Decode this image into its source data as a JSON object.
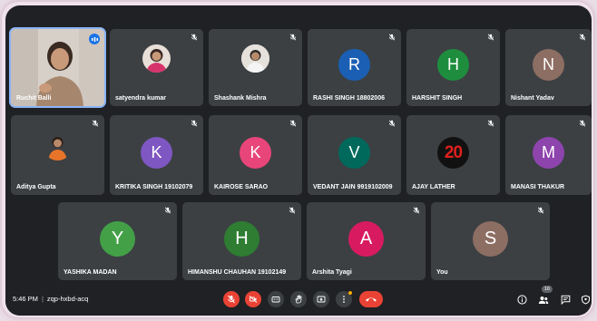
{
  "tiles": [
    {
      "name": "Ruchit Balli",
      "type": "video"
    },
    {
      "name": "satyendra kumar",
      "type": "photo"
    },
    {
      "name": "Shashank Mishra",
      "type": "photo"
    },
    {
      "name": "RASHI SINGH 18802006",
      "initial": "R",
      "color": "#1a5fb4"
    },
    {
      "name": "HARSHIT SINGH",
      "initial": "H",
      "color": "#1e8e3e"
    },
    {
      "name": "Nishant Yadav",
      "initial": "N",
      "color": "#8d6e63"
    },
    {
      "name": "Aditya Gupta",
      "type": "photo"
    },
    {
      "name": "KRITIKA SINGH 19102079",
      "initial": "K",
      "color": "#7e57c2"
    },
    {
      "name": "KAIROSE SARAO",
      "initial": "K",
      "color": "#e8457a"
    },
    {
      "name": "VEDANT JAIN 9919102009",
      "initial": "V",
      "color": "#00695c"
    },
    {
      "name": "AJAY LATHER",
      "type": "photo",
      "photo_text": "20"
    },
    {
      "name": "MANASI THAKUR",
      "initial": "M",
      "color": "#8e44ad"
    },
    {
      "name": "YASHIKA MADAN",
      "initial": "Y",
      "color": "#43a047"
    },
    {
      "name": "HIMANSHU CHAUHAN 19102149",
      "initial": "H",
      "color": "#2e7d32"
    },
    {
      "name": "Arshita Tyagi",
      "initial": "A",
      "color": "#d81b60"
    },
    {
      "name": "You",
      "initial": "S",
      "color": "#8d6e63"
    }
  ],
  "bottom_bar": {
    "time": "5:46 PM",
    "separator": "|",
    "meeting_code": "zqp-hxbd-acq",
    "participant_count": "16"
  },
  "colors": {
    "background": "#202124",
    "tile": "#3c4043",
    "danger": "#ea4335",
    "active_speaker": "#8ab4f8"
  },
  "icons": [
    "mic-off-icon",
    "camera-off-icon",
    "captions-icon",
    "raise-hand-icon",
    "present-icon",
    "more-options-icon",
    "end-call-icon",
    "info-icon",
    "people-icon",
    "chat-icon",
    "activities-icon"
  ]
}
